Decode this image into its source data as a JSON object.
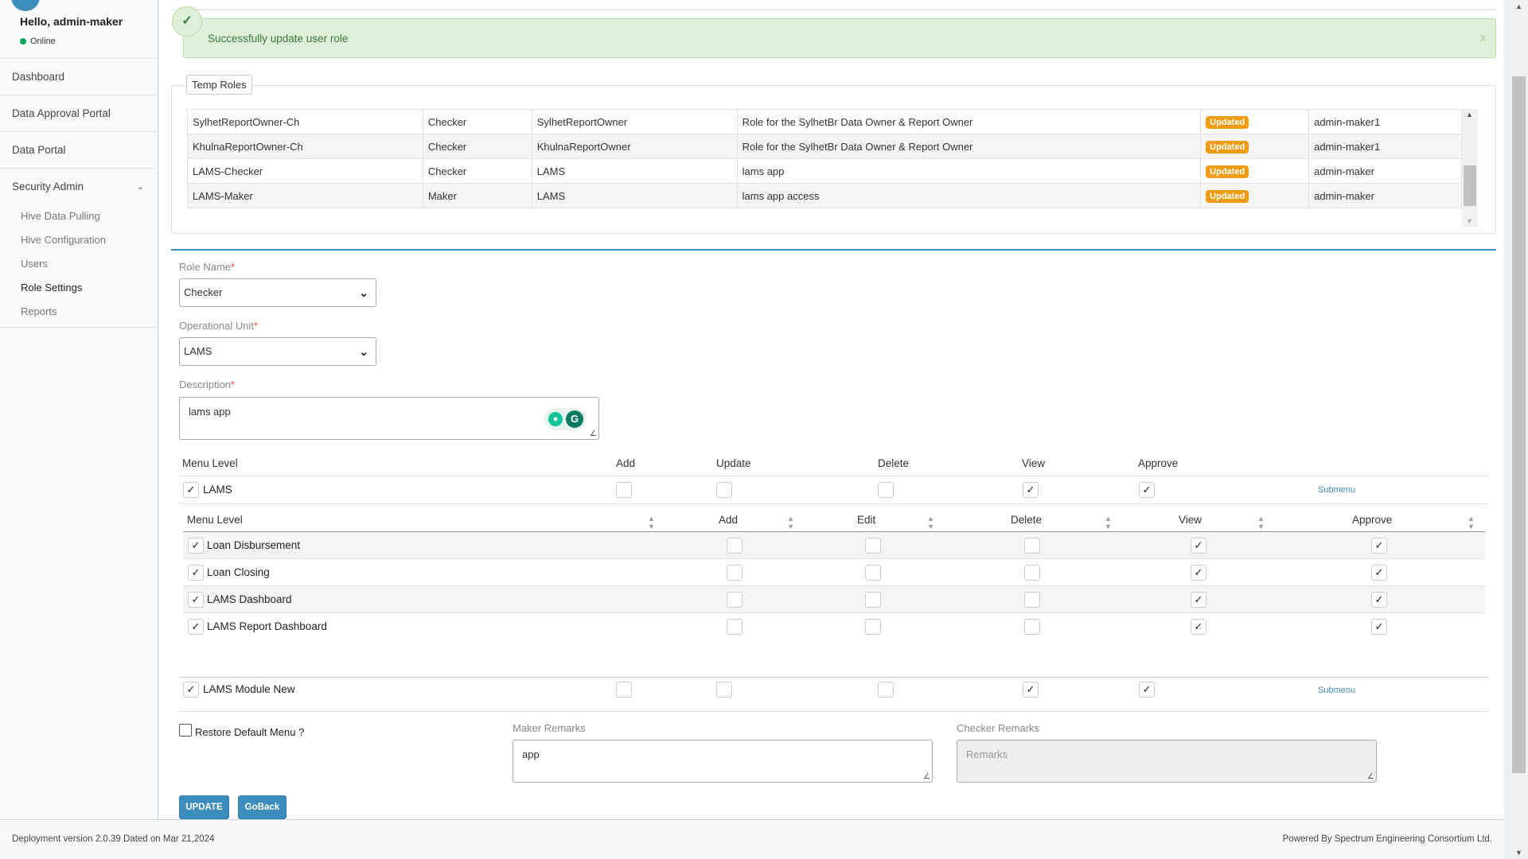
{
  "user": {
    "greeting": "Hello, admin-maker",
    "status": "Online"
  },
  "nav": {
    "items": [
      "Dashboard",
      "Data Approval Portal",
      "Data Portal"
    ],
    "security": {
      "label": "Security Admin",
      "chevron_icon": "chevron-down-icon",
      "items": [
        "Hive Data Pulling",
        "Hive Configuration",
        "Users",
        "Role Settings",
        "Reports"
      ],
      "active": "Role Settings"
    }
  },
  "alert": {
    "message": "Successfully update user role",
    "close": "x",
    "icon": "check-icon",
    "color": "#dff0d8"
  },
  "temp_roles": {
    "legend": "Temp Roles",
    "rows": [
      {
        "name": "SylhetReportOwner-Ch",
        "type": "Checker",
        "unit": "SylhetReportOwner",
        "description": "Role for the SylhetBr Data Owner & Report Owner",
        "status": "Updated",
        "user": "admin-maker1"
      },
      {
        "name": "KhulnaReportOwner-Ch",
        "type": "Checker",
        "unit": "KhulnaReportOwner",
        "description": "Role for the SylhetBr Data Owner & Report Owner",
        "status": "Updated",
        "user": "admin-maker1"
      },
      {
        "name": "LAMS-Checker",
        "type": "Checker",
        "unit": "LAMS",
        "description": "lams app",
        "status": "Updated",
        "user": "admin-maker"
      },
      {
        "name": "LAMS-Maker",
        "type": "Maker",
        "unit": "LAMS",
        "description": "lams app access",
        "status": "Updated",
        "user": "admin-maker"
      }
    ],
    "badge_color": "#f39c12"
  },
  "form": {
    "role_name": {
      "label": "Role Name",
      "required": "*",
      "value": "Checker"
    },
    "operational_unit": {
      "label": "Operational Unit",
      "required": "*",
      "value": "LAMS"
    },
    "description": {
      "label": "Description",
      "required": "*",
      "value": "lams app"
    },
    "menu_headers": {
      "menu_level": "Menu Level",
      "add": "Add",
      "update": "Update",
      "delete": "Delete",
      "view": "View",
      "approve": "Approve"
    },
    "menus": [
      {
        "label": "LAMS",
        "checked": true,
        "add": false,
        "update": false,
        "delete": false,
        "view": true,
        "approve": true,
        "submenu_link": "Submenu"
      },
      {
        "label": "LAMS Module New",
        "checked": true,
        "add": false,
        "update": false,
        "delete": false,
        "view": true,
        "approve": true,
        "submenu_link": "Submenu"
      }
    ],
    "submenu_headers": {
      "menu_level": "Menu Level",
      "add": "Add",
      "edit": "Edit",
      "delete": "Delete",
      "view": "View",
      "approve": "Approve"
    },
    "submenus": [
      {
        "label": "Loan Disbursement",
        "checked": true,
        "add": false,
        "edit": false,
        "delete": false,
        "view": true,
        "approve": true
      },
      {
        "label": "Loan Closing",
        "checked": true,
        "add": false,
        "edit": false,
        "delete": false,
        "view": true,
        "approve": true
      },
      {
        "label": "LAMS Dashboard",
        "checked": true,
        "add": false,
        "edit": false,
        "delete": false,
        "view": true,
        "approve": true
      },
      {
        "label": "LAMS Report Dashboard",
        "checked": true,
        "add": false,
        "edit": false,
        "delete": false,
        "view": true,
        "approve": true
      }
    ],
    "restore_default": {
      "label": "Restore Default Menu ?",
      "checked": false
    },
    "maker_remarks": {
      "label": "Maker Remarks",
      "value": "app"
    },
    "checker_remarks": {
      "label": "Checker Remarks",
      "placeholder": "Remarks"
    },
    "buttons": {
      "update": "UPDATE",
      "goback": "GoBack"
    }
  },
  "footer": {
    "version": "Deployment version 2.0.39 Dated on Mar 21,2024",
    "powered": "Powered By Spectrum Engineering Consortium Ltd."
  },
  "colors": {
    "primary": "#3c8dbc",
    "success_bg": "#dff0d8",
    "badge": "#f39c12"
  }
}
